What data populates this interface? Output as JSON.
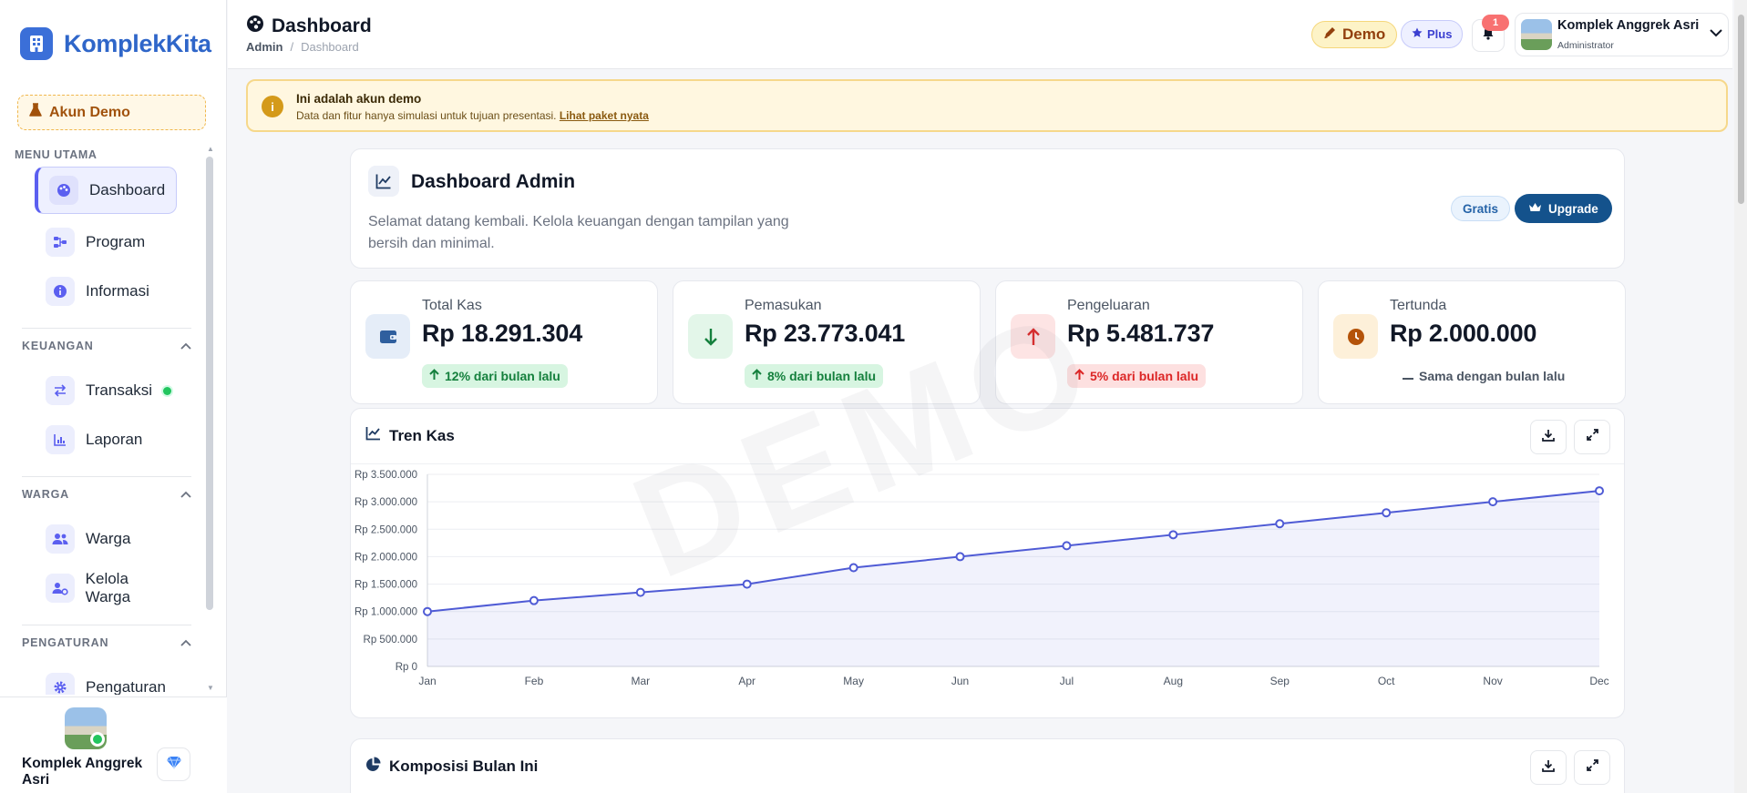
{
  "sidebar": {
    "brand": "KomplekKita",
    "demo_label": "Akun Demo",
    "main_menu_title": "MENU UTAMA",
    "main_items": [
      {
        "label": "Dashboard",
        "icon": "palette-icon"
      },
      {
        "label": "Program",
        "icon": "diagram-icon"
      },
      {
        "label": "Informasi",
        "icon": "info-icon"
      }
    ],
    "groups": [
      {
        "title": "KEUANGAN",
        "items": [
          {
            "label": "Transaksi",
            "icon": "exchange-icon",
            "has_dot": true
          },
          {
            "label": "Laporan",
            "icon": "chart-icon"
          }
        ]
      },
      {
        "title": "WARGA",
        "items": [
          {
            "label": "Warga",
            "icon": "users-icon"
          },
          {
            "label": "Kelola Warga",
            "icon": "user-gear-icon"
          }
        ]
      },
      {
        "title": "PENGATURAN",
        "items": [
          {
            "label": "Pengaturan",
            "icon": "gear-icon"
          }
        ]
      }
    ],
    "footer_name": "Komplek Anggrek Asri"
  },
  "topbar": {
    "title": "Dashboard",
    "breadcrumb_root": "Admin",
    "breadcrumb_sep": "/",
    "breadcrumb_current": "Dashboard",
    "demo_badge": "Demo",
    "plus_badge": "Plus",
    "notification_count": "1",
    "profile_name": "Komplek Anggrek Asri",
    "profile_role": "Administrator"
  },
  "banner": {
    "title": "Ini adalah akun demo",
    "text": "Data dan fitur hanya simulasi untuk tujuan presentasi.",
    "link": "Lihat paket nyata"
  },
  "welcome": {
    "title": "Dashboard Admin",
    "subtitle": "Selamat datang kembali. Kelola keuangan dengan tampilan yang bersih dan minimal.",
    "plan": "Gratis",
    "upgrade": "Upgrade"
  },
  "stats": [
    {
      "label": "Total Kas",
      "value": "Rp 18.291.304",
      "change": "12% dari bulan lalu",
      "trend": "up",
      "color": "#2f5f9e"
    },
    {
      "label": "Pemasukan",
      "value": "Rp 23.773.041",
      "change": "8% dari bulan lalu",
      "trend": "up",
      "color": "#15803d"
    },
    {
      "label": "Pengeluaran",
      "value": "Rp 5.481.737",
      "change": "5% dari bulan lalu",
      "trend": "down",
      "color": "#dc2626"
    },
    {
      "label": "Tertunda",
      "value": "Rp 2.000.000",
      "change": "Sama dengan bulan lalu",
      "trend": "flat",
      "color": "#b45309"
    }
  ],
  "watermark": "DEMO",
  "chart_card": {
    "title": "Tren Kas"
  },
  "composition_card": {
    "title": "Komposisi Bulan Ini"
  },
  "chart_data": {
    "type": "area",
    "title": "Tren Kas",
    "categories": [
      "Jan",
      "Feb",
      "Mar",
      "Apr",
      "May",
      "Jun",
      "Jul",
      "Aug",
      "Sep",
      "Oct",
      "Nov",
      "Dec"
    ],
    "values": [
      1000000,
      1200000,
      1350000,
      1500000,
      1800000,
      2000000,
      2200000,
      2400000,
      2600000,
      2800000,
      3000000,
      3200000
    ],
    "ylim": [
      0,
      3500000
    ],
    "yticks": [
      "Rp 0",
      "Rp 500.000",
      "Rp 1.000.000",
      "Rp 1.500.000",
      "Rp 2.000.000",
      "Rp 2.500.000",
      "Rp 3.000.000",
      "Rp 3.500.000"
    ],
    "grid": true,
    "color": "#4f5bd5"
  }
}
